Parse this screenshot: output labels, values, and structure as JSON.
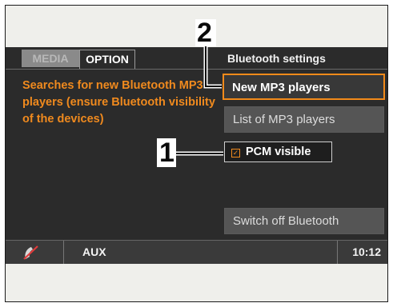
{
  "tabs": [
    {
      "label": "MEDIA",
      "active": false
    },
    {
      "label": "OPTION",
      "active": true
    }
  ],
  "section_title": "Bluetooth settings",
  "help_text": "Searches for new Bluetooth MP3 players (ensure Bluetooth visibility of the devices)",
  "buttons": {
    "new_mp3": "New MP3 players",
    "list_mp3": "List of MP3 players",
    "pcm_visible": "PCM visible",
    "switch_off": "Switch off Bluetooth"
  },
  "pcm_visible_checked": true,
  "status": {
    "source": "AUX",
    "time": "10:12",
    "phone_icon": "phone-disconnected-icon"
  },
  "callouts": {
    "one": "1",
    "two": "2"
  },
  "colors": {
    "accent": "#f28a1a",
    "screen_bg": "#2b2b2b"
  }
}
